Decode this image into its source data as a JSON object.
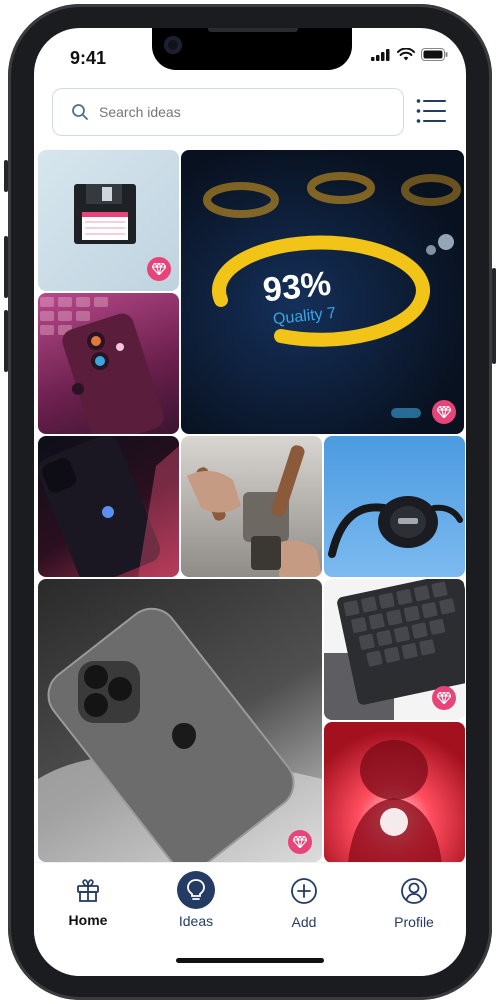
{
  "status_bar": {
    "time": "9:41"
  },
  "search": {
    "placeholder": "Search ideas"
  },
  "nav": {
    "home": "Home",
    "ideas": "Ideas",
    "add": "Add",
    "profile": "Profile",
    "active": "ideas"
  },
  "colors": {
    "accent": "#243b63",
    "gem": "#e8447a"
  },
  "tiles": [
    {
      "subject": "floppy disk",
      "gem": true
    },
    {
      "subject": "quality display",
      "caption_main": "93%",
      "caption_sub": "Quality 7",
      "gem": true
    },
    {
      "subject": "phone on keyboard",
      "gem": false
    },
    {
      "subject": "iphone red light",
      "gem": false
    },
    {
      "subject": "coffee machine",
      "gem": false
    },
    {
      "subject": "headphones",
      "gem": false
    },
    {
      "subject": "iphone pro",
      "gem": true
    },
    {
      "subject": "keyboard",
      "gem": true
    },
    {
      "subject": "red figure",
      "gem": false
    }
  ]
}
